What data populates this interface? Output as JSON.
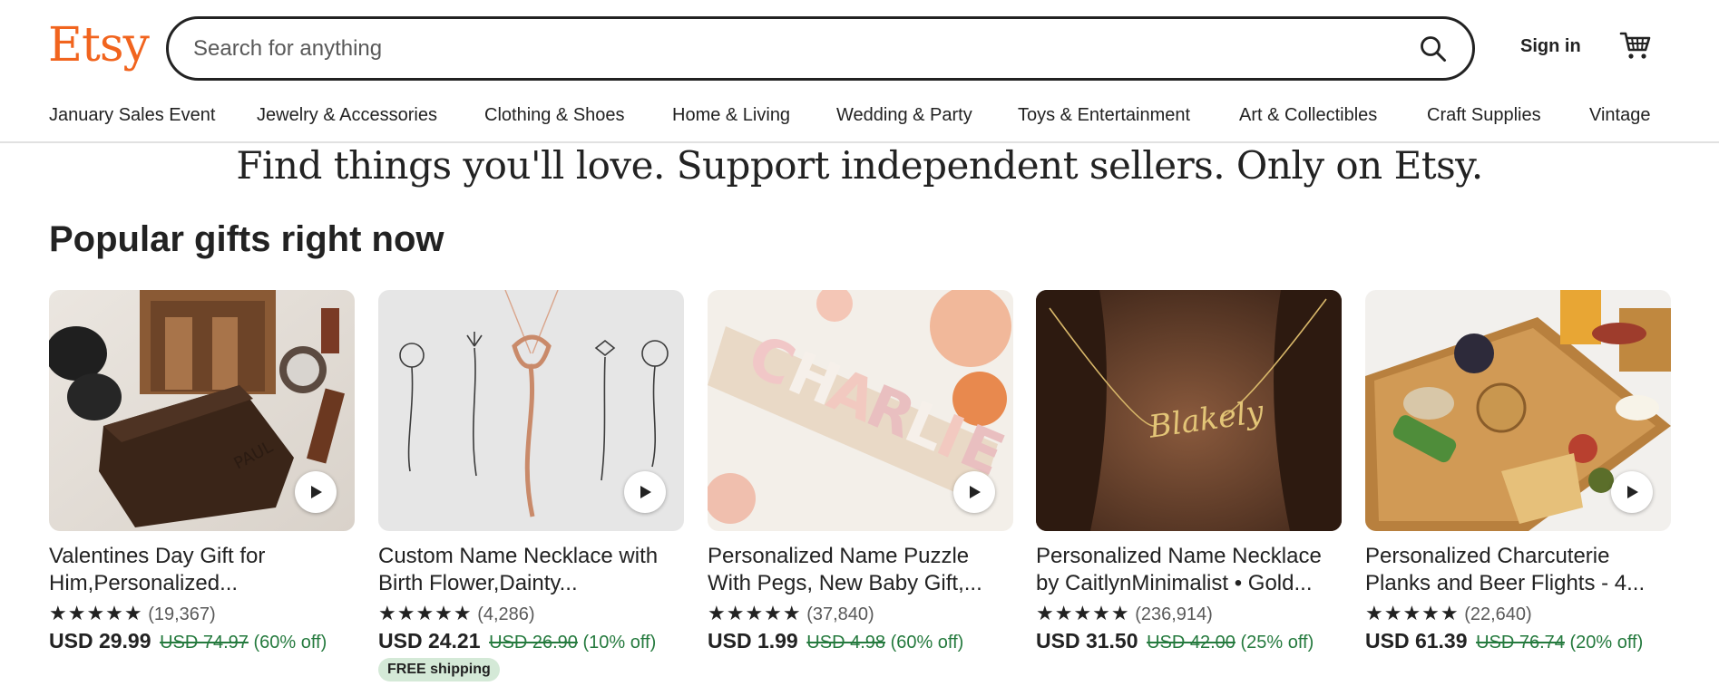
{
  "header": {
    "logo": "Etsy",
    "search_placeholder": "Search for anything",
    "sign_in": "Sign in"
  },
  "nav": {
    "items": [
      "January Sales Event",
      "Jewelry & Accessories",
      "Clothing & Shoes",
      "Home & Living",
      "Wedding & Party",
      "Toys & Entertainment",
      "Art & Collectibles",
      "Craft Supplies",
      "Vintage"
    ]
  },
  "tagline": "Find things you'll love. Support independent sellers. Only on Etsy.",
  "section_title": "Popular gifts right now",
  "products": [
    {
      "title_line1": "Valentines Day Gift for",
      "title_line2": "Him,Personalized...",
      "stars": "★★★★★",
      "reviews": "(19,367)",
      "price": "USD 29.99",
      "original_price": "USD 74.97",
      "discount": "(60% off)",
      "badge": ""
    },
    {
      "title_line1": "Custom Name Necklace with",
      "title_line2": "Birth Flower,Dainty...",
      "stars": "★★★★★",
      "reviews": "(4,286)",
      "price": "USD 24.21",
      "original_price": "USD 26.90",
      "discount": "(10% off)",
      "badge": "FREE shipping"
    },
    {
      "title_line1": "Personalized Name Puzzle",
      "title_line2": "With Pegs, New Baby Gift,...",
      "stars": "★★★★★",
      "reviews": "(37,840)",
      "price": "USD 1.99",
      "original_price": "USD 4.98",
      "discount": "(60% off)",
      "badge": ""
    },
    {
      "title_line1": "Personalized Name Necklace",
      "title_line2": "by CaitlynMinimalist • Gold...",
      "stars": "★★★★★",
      "reviews": "(236,914)",
      "price": "USD 31.50",
      "original_price": "USD 42.00",
      "discount": "(25% off)",
      "badge": ""
    },
    {
      "title_line1": "Personalized Charcuterie",
      "title_line2": "Planks and Beer Flights - 4...",
      "stars": "★★★★★",
      "reviews": "(22,640)",
      "price": "USD 61.39",
      "original_price": "USD 76.74",
      "discount": "(20% off)",
      "badge": ""
    }
  ],
  "colors": {
    "brand": "#f1641e",
    "discount": "#257a3e",
    "badge_bg": "#d4e9d7"
  }
}
